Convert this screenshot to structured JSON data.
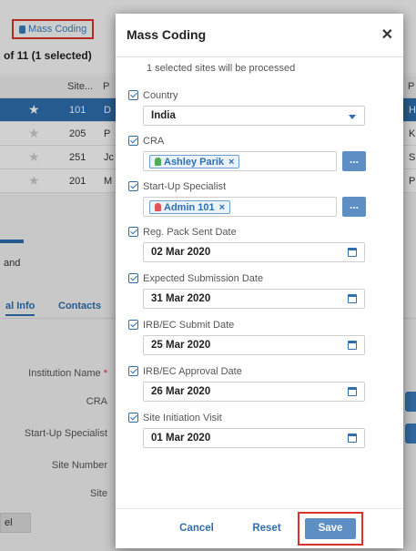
{
  "background": {
    "mass_coding_link": "Mass Coding",
    "row_count": "of 11 (1 selected)",
    "table": {
      "headers": [
        "Site...",
        "P",
        "P"
      ],
      "rows": [
        {
          "site": "101",
          "c2": "D",
          "c3": "H",
          "selected": true
        },
        {
          "site": "205",
          "c2": "P",
          "c3": "K",
          "selected": false
        },
        {
          "site": "251",
          "c2": "Jc",
          "c3": "S",
          "selected": false
        },
        {
          "site": "201",
          "c2": "M",
          "c3": "P",
          "selected": false
        }
      ]
    },
    "section_label": "and",
    "tabs": [
      "al Info",
      "Contacts"
    ],
    "form_labels": {
      "institution": "Institution Name",
      "required_mark": "*",
      "cra": "CRA",
      "startup": "Start-Up Specialist",
      "site_number": "Site Number",
      "site": "Site"
    },
    "footer_button": "el"
  },
  "modal": {
    "title": "Mass Coding",
    "close_icon": "close-icon",
    "subtitle": "1 selected sites will be processed",
    "fields": {
      "country": {
        "label": "Country",
        "value": "India"
      },
      "cra": {
        "label": "CRA",
        "chip": "Ashley Parik"
      },
      "startup": {
        "label": "Start-Up Specialist",
        "chip": "Admin 101"
      },
      "reg_pack": {
        "label": "Reg. Pack Sent Date",
        "value": "02 Mar 2020"
      },
      "expected_sub": {
        "label": "Expected Submission Date",
        "value": "31 Mar 2020"
      },
      "irb_submit": {
        "label": "IRB/EC Submit Date",
        "value": "25 Mar 2020"
      },
      "irb_approval": {
        "label": "IRB/EC Approval Date",
        "value": "26 Mar 2020"
      },
      "initiation": {
        "label": "Site Initiation Visit",
        "value": "01 Mar 2020"
      }
    },
    "dots_label": "...",
    "chip_remove": "×",
    "buttons": {
      "cancel": "Cancel",
      "reset": "Reset",
      "save": "Save"
    }
  },
  "colors": {
    "accent": "#2f6fb0",
    "highlight": "#d9342b",
    "primary_button": "#5d8fc4"
  }
}
